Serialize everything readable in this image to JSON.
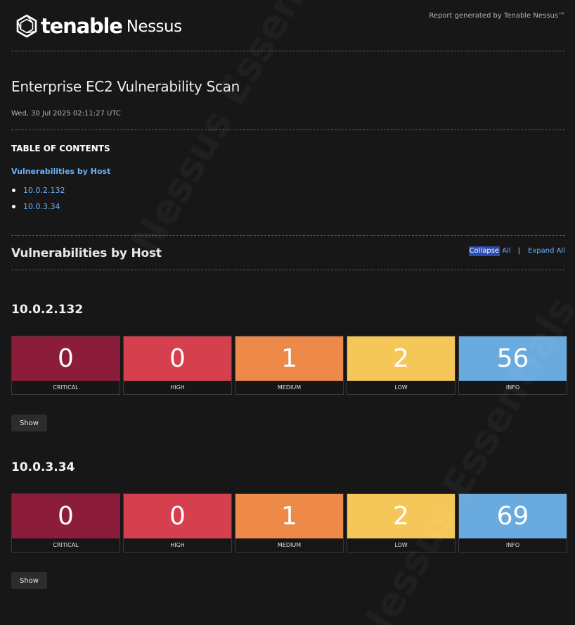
{
  "header": {
    "brand": "tenable",
    "product": "Nessus",
    "generated": "Report generated by Tenable Nessus™",
    "logo_icon": "tenable-hexagon-logo-icon"
  },
  "scan": {
    "title": "Enterprise EC2 Vulnerability Scan",
    "date": "Wed, 30 Jul 2025 02:11:27 UTC"
  },
  "toc": {
    "heading": "TABLE OF CONTENTS",
    "section_link": "Vulnerabilities by Host",
    "items": [
      "10.0.2.132",
      "10.0.3.34"
    ]
  },
  "section": {
    "title": "Vulnerabilities by Host",
    "collapse_selected": "Collapse",
    "collapse_rest": " All",
    "separator": "|",
    "expand": "Expand All"
  },
  "watermark": "Nessus Essentials",
  "severity_colors": {
    "critical": "#8b1d3a",
    "high": "#d6404e",
    "medium": "#ed8a49",
    "low": "#f5c758",
    "info": "#6aabdf"
  },
  "hosts": [
    {
      "ip": "10.0.2.132",
      "show_label": "Show",
      "counts": [
        {
          "label": "CRITICAL",
          "value": "0"
        },
        {
          "label": "HIGH",
          "value": "0"
        },
        {
          "label": "MEDIUM",
          "value": "1"
        },
        {
          "label": "LOW",
          "value": "2"
        },
        {
          "label": "INFO",
          "value": "56"
        }
      ]
    },
    {
      "ip": "10.0.3.34",
      "show_label": "Show",
      "counts": [
        {
          "label": "CRITICAL",
          "value": "0"
        },
        {
          "label": "HIGH",
          "value": "0"
        },
        {
          "label": "MEDIUM",
          "value": "1"
        },
        {
          "label": "LOW",
          "value": "2"
        },
        {
          "label": "INFO",
          "value": "69"
        }
      ]
    }
  ]
}
